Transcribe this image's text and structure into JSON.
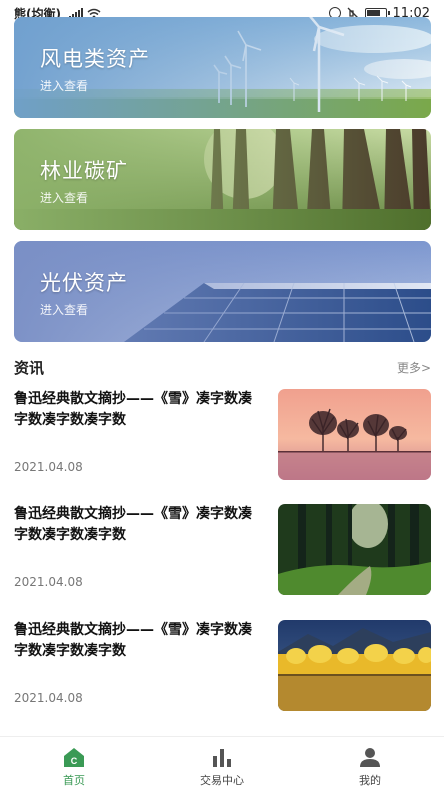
{
  "status_bar": {
    "carrier": "熊(均衡)",
    "time": "11:02"
  },
  "banners": [
    {
      "title": "风电类资产",
      "subtitle": "进入查看",
      "scene": "wind-turbines"
    },
    {
      "title": "林业碳矿",
      "subtitle": "进入查看",
      "scene": "forest"
    },
    {
      "title": "光伏资产",
      "subtitle": "进入查看",
      "scene": "solar-panels"
    }
  ],
  "news": {
    "title": "资讯",
    "more_label": "更多>",
    "items": [
      {
        "title": "鲁迅经典散文摘抄——《雪》凑字数凑字数凑字数凑字数",
        "date": "2021.04.08",
        "thumb": "sunset-trees"
      },
      {
        "title": "鲁迅经典散文摘抄——《雪》凑字数凑字数凑字数凑字数",
        "date": "2021.04.08",
        "thumb": "forest-path"
      },
      {
        "title": "鲁迅经典散文摘抄——《雪》凑字数凑字数凑字数凑字数",
        "date": "2021.04.08",
        "thumb": "autumn-lake"
      }
    ]
  },
  "tabs": [
    {
      "label": "首页",
      "icon": "home-icon",
      "active": true
    },
    {
      "label": "交易中心",
      "icon": "bar-chart-icon",
      "active": false
    },
    {
      "label": "我的",
      "icon": "user-icon",
      "active": false
    }
  ],
  "colors": {
    "accent": "#3a9a55",
    "banner_wind": "#6f9fce",
    "banner_forest": "#8db26a",
    "banner_solar": "#7a8fc5"
  }
}
